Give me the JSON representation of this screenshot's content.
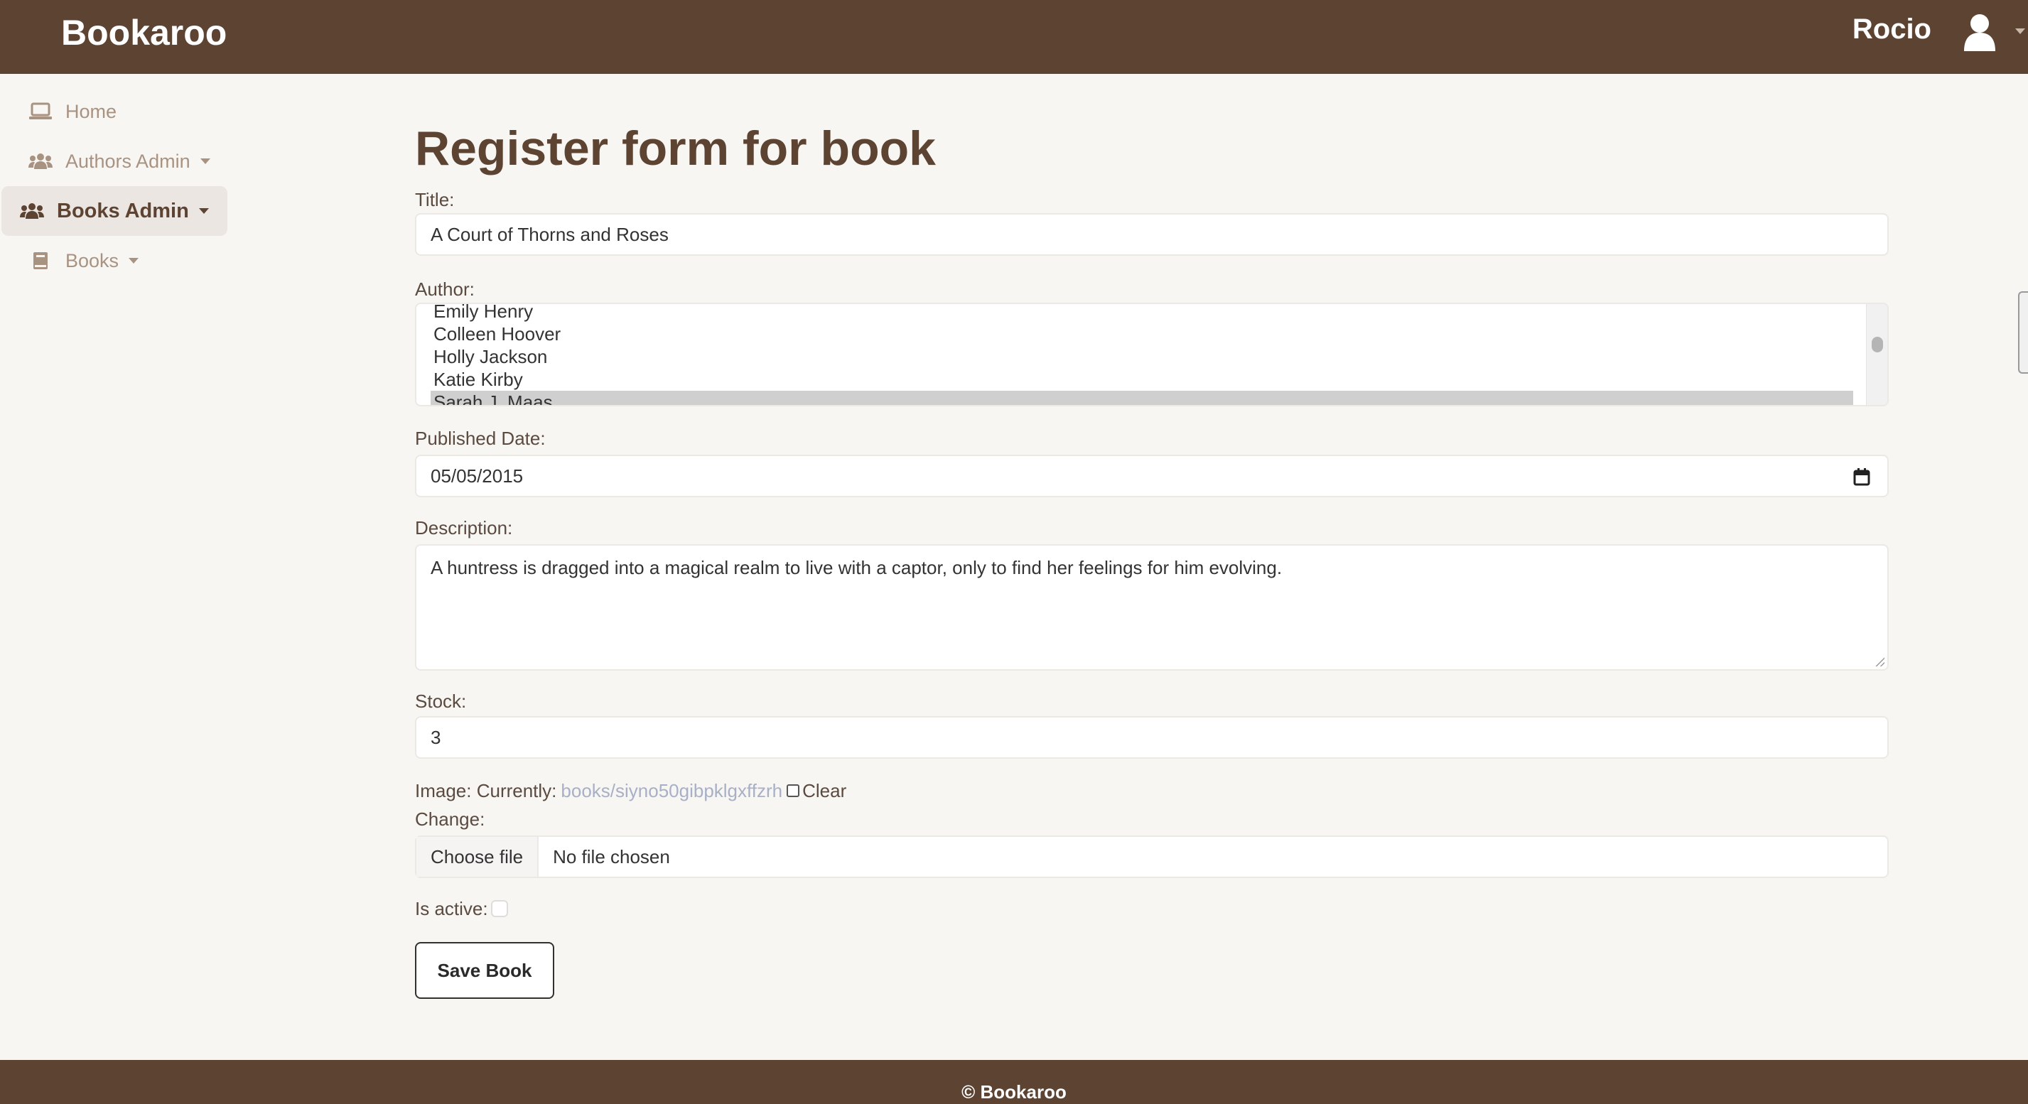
{
  "app": {
    "brand": "Bookaroo"
  },
  "user": {
    "name": "Rocio"
  },
  "sidebar": {
    "items": [
      {
        "label": "Home",
        "icon": "laptop-icon"
      },
      {
        "label": "Authors Admin",
        "icon": "users-icon"
      },
      {
        "label": "Books Admin",
        "icon": "users-icon"
      },
      {
        "label": "Books",
        "icon": "book-icon"
      }
    ]
  },
  "form": {
    "heading": "Register form for book",
    "title_label": "Title:",
    "title_value": "A Court of Thorns and Roses",
    "author_label": "Author:",
    "author_options": [
      "Emily Henry",
      "Colleen Hoover",
      "Holly Jackson",
      "Katie Kirby",
      "Sarah J. Maas"
    ],
    "author_selected": "Sarah J. Maas",
    "published_label": "Published Date:",
    "published_value": "05/05/2015",
    "description_label": "Description:",
    "description_value": "A huntress is dragged into a magical realm to live with a captor, only to find her feelings for him evolving.",
    "stock_label": "Stock:",
    "stock_value": "3",
    "image_label": "Image: Currently:",
    "image_current": "books/siyno50gibpklgxffzrh",
    "image_clear_label": "Clear",
    "change_label": "Change:",
    "file_button": "Choose file",
    "file_status": "No file chosen",
    "is_active_label": "Is active:",
    "save_label": "Save Book"
  },
  "footer": {
    "text": "© Bookaroo"
  },
  "colors": {
    "brand": "#5d4332",
    "background": "#f8f6f2",
    "link": "#a8b0c8"
  }
}
